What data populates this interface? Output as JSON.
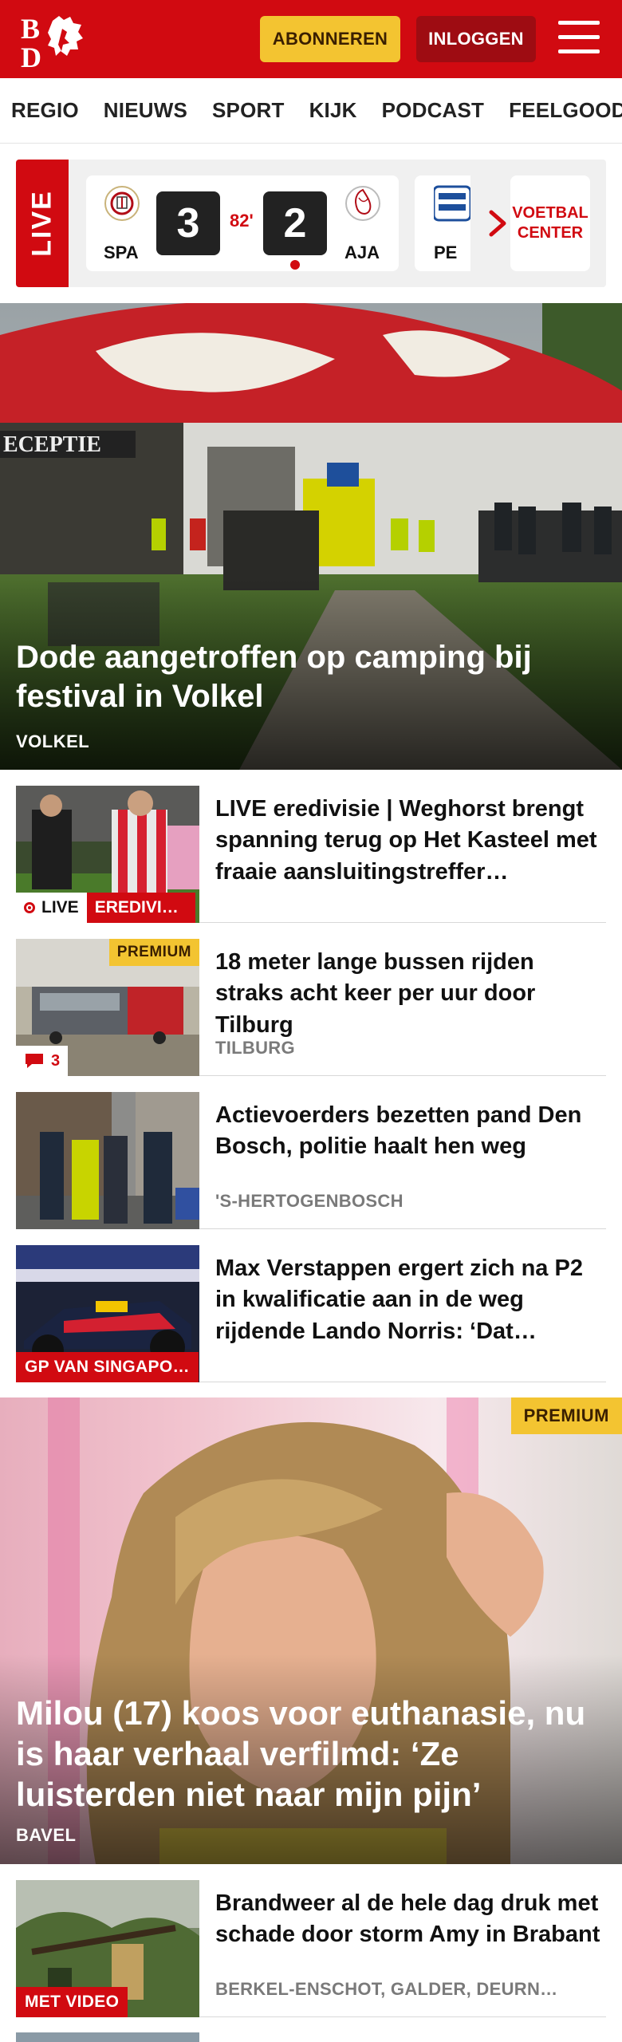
{
  "header": {
    "logo_text": "BD",
    "subscribe_label": "ABONNEREN",
    "login_label": "INLOGGEN"
  },
  "nav": {
    "items": [
      "REGIO",
      "NIEUWS",
      "SPORT",
      "KIJK",
      "PODCAST",
      "FEELGOOD"
    ]
  },
  "live": {
    "label": "LIVE",
    "match": {
      "home": "SPA",
      "away": "AJA",
      "home_score": "3",
      "away_score": "2",
      "minute": "82'"
    },
    "next_team": "PE",
    "center_label": "VOETBAL CENTER"
  },
  "hero": {
    "title": "Dode aangetroffen op camping bij festival in Volkel",
    "location": "VOLKEL"
  },
  "articles": [
    {
      "title": "LIVE eredivisie | Weghorst brengt spanning terug op Het Kasteel met fraaie aansluitingstreffer…",
      "live_label": "LIVE",
      "category": "EREDIVI…"
    },
    {
      "title": "18 meter lange bussen rijden straks acht keer per uur door Tilburg",
      "location": "TILBURG",
      "premium": "PREMIUM",
      "comments": "3"
    },
    {
      "title": "Actievoerders bezetten pand Den Bosch, politie haalt hen weg",
      "location": "'S-HERTOGENBOSCH"
    },
    {
      "title": "Max Verstappen ergert zich na P2 in kwalificatie aan in de weg rijdende Lando Norris: ‘Dat…",
      "category": "GP VAN SINGAPO…"
    },
    {
      "title": "Brandweer al de hele dag druk met schade door storm Amy in Brabant",
      "location": "BERKEL-ENSCHOT, GALDER, DEURN…",
      "category": "MET VIDEO"
    }
  ],
  "feature": {
    "premium": "PREMIUM",
    "title": "Milou (17) koos voor euthanasie, nu is haar verhaal verfilmd: ‘Ze luisterden niet naar mijn pijn’",
    "location": "BAVEL"
  },
  "colors": {
    "brand": "#d10a11",
    "premium": "#f3c431"
  }
}
